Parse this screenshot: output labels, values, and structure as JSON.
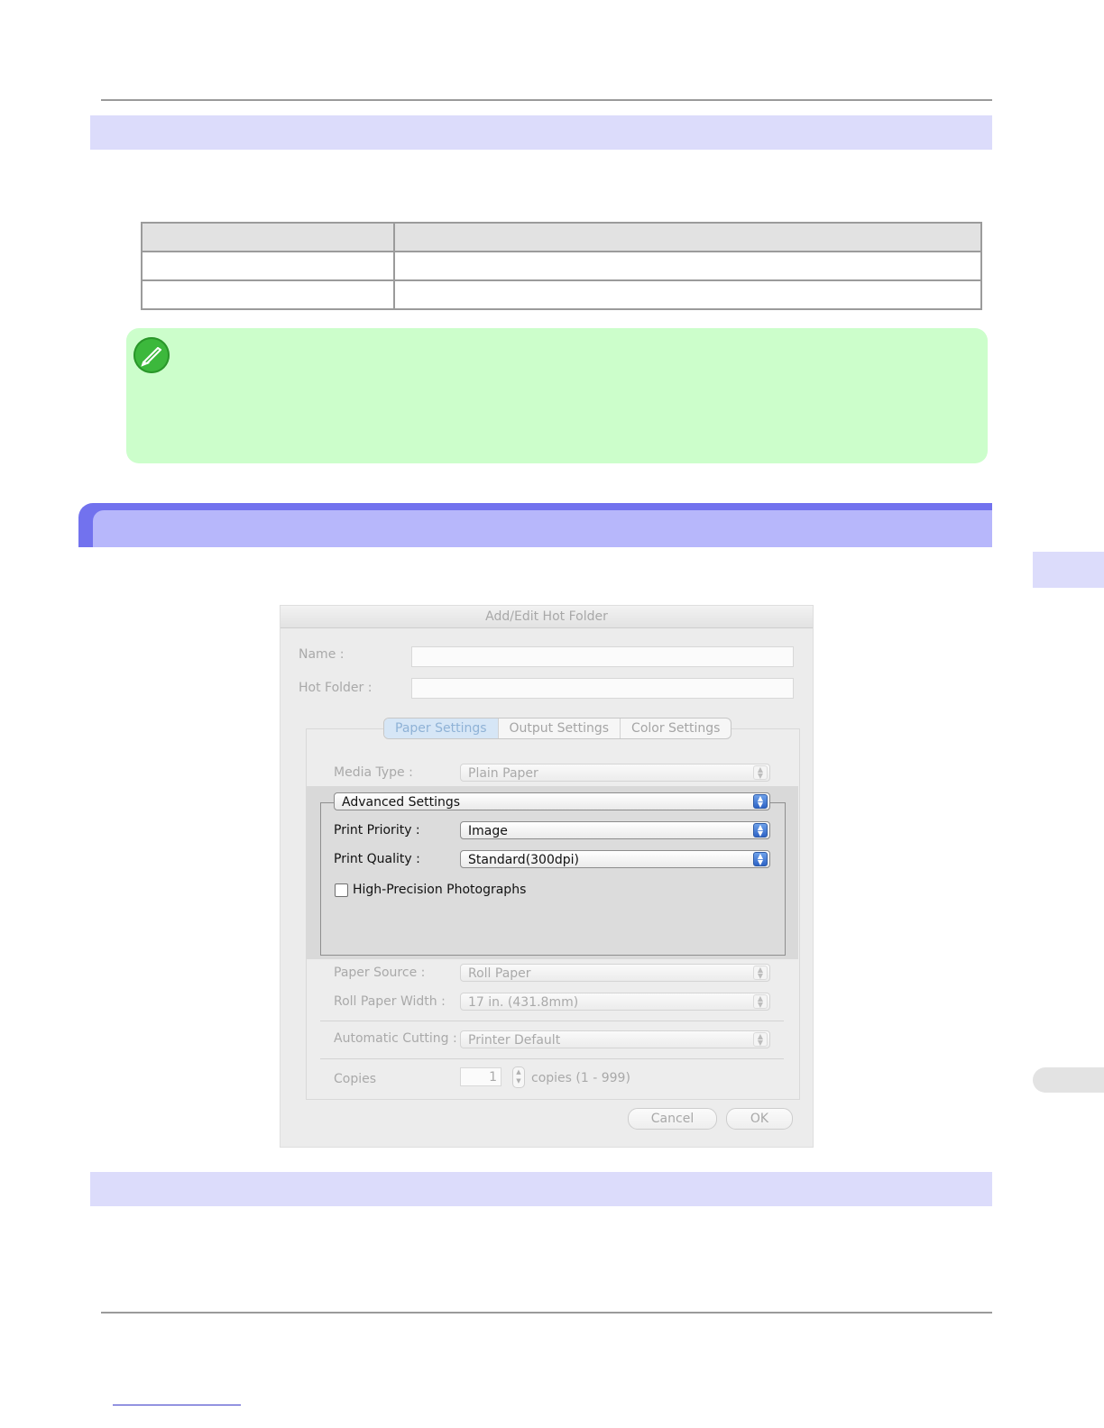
{
  "dialog": {
    "title": "Add/Edit Hot Folder",
    "name_label": "Name :",
    "name_value": "",
    "hot_folder_label": "Hot Folder :",
    "hot_folder_value": "",
    "tabs": [
      "Paper Settings",
      "Output Settings",
      "Color Settings"
    ],
    "active_tab": "Paper Settings",
    "media_type_label": "Media Type :",
    "media_type_value": "Plain Paper",
    "advanced_settings_value": "Advanced Settings",
    "print_priority_label": "Print Priority :",
    "print_priority_value": "Image",
    "print_quality_label": "Print Quality :",
    "print_quality_value": "Standard(300dpi)",
    "high_precision_label": "High-Precision Photographs",
    "high_precision_checked": false,
    "paper_source_label": "Paper Source :",
    "paper_source_value": "Roll Paper",
    "roll_width_label": "Roll Paper Width :",
    "roll_width_value": "17 in. (431.8mm)",
    "auto_cut_label": "Automatic Cutting :",
    "auto_cut_value": "Printer Default",
    "copies_label": "Copies",
    "copies_value": "1",
    "copies_range": "copies (1 - 999)",
    "cancel_label": "Cancel",
    "ok_label": "OK"
  },
  "colors": {
    "section_bar": "#dcdcfb",
    "chapter_bar": "#b7b7fb",
    "chapter_bar_edge": "#7272ee",
    "note_background": "#ccfecb",
    "note_icon": "#3cb83c",
    "table_header": "#e2e2e2",
    "popup_arrow_active": "#2e64c6"
  },
  "icons": {
    "note": "pencil-note-icon",
    "popup_arrows": "up-down-chevron-icon",
    "stepper": "up-down-stepper-icon"
  }
}
